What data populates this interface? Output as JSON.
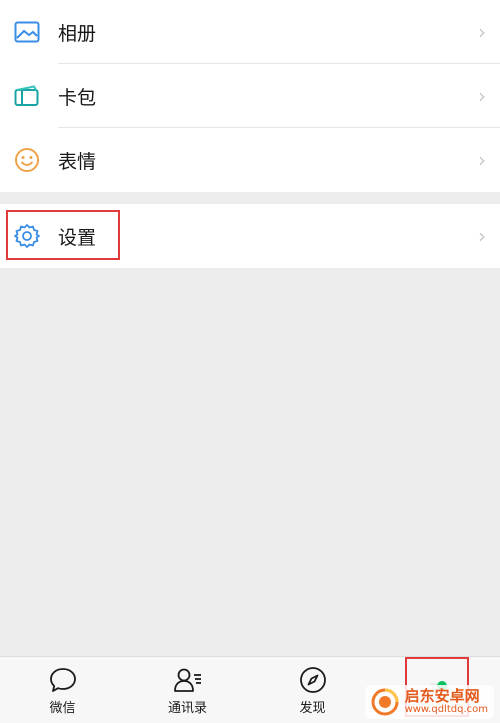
{
  "menu": {
    "items": [
      {
        "label": "相册",
        "icon": "album-icon"
      },
      {
        "label": "卡包",
        "icon": "card-wallet-icon"
      },
      {
        "label": "表情",
        "icon": "sticker-smile-icon"
      }
    ],
    "settings": {
      "label": "设置",
      "icon": "gear-icon"
    }
  },
  "tabbar": {
    "tabs": [
      {
        "label": "微信",
        "icon": "chat-bubble-icon"
      },
      {
        "label": "通讯录",
        "icon": "contacts-icon"
      },
      {
        "label": "发现",
        "icon": "compass-icon"
      },
      {
        "label": "",
        "icon": "me-avatar-icon"
      }
    ]
  },
  "watermark": {
    "title": "启东安卓网",
    "url": "www.qdltdq.com"
  },
  "colors": {
    "accent_green": "#07c160",
    "highlight_red": "#e03a3a",
    "album_blue": "#3a8ee6",
    "card_teal": "#1aa3a3",
    "smile_orange": "#f0a24a",
    "gear_blue": "#3a8ee6"
  }
}
